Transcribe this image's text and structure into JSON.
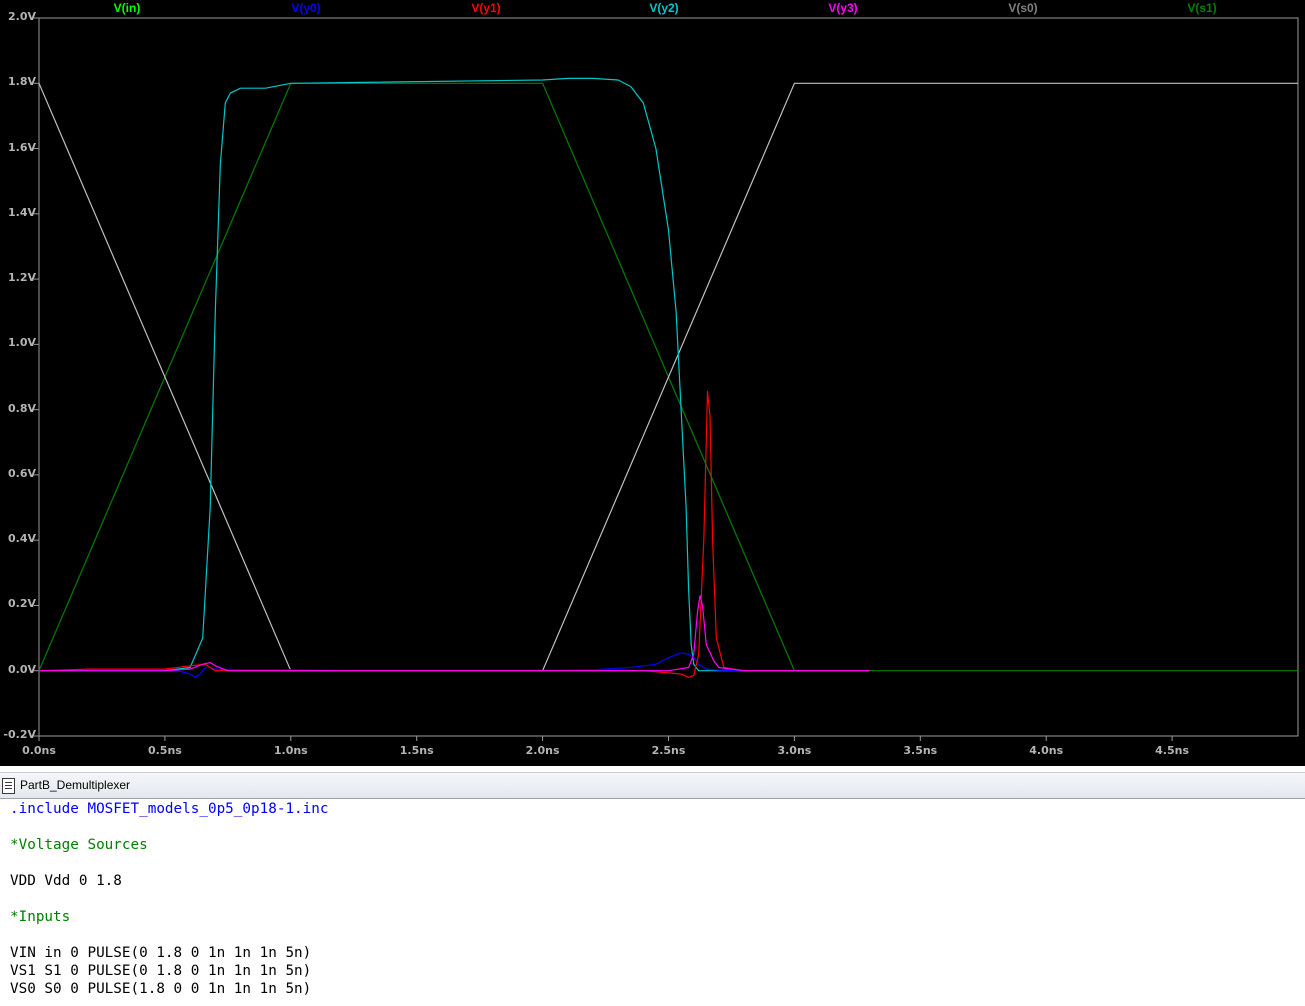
{
  "plot": {
    "background": "#000000",
    "traces": [
      {
        "label": "V(in)",
        "color": "#00ff00"
      },
      {
        "label": "V(y0)",
        "color": "#0000ff"
      },
      {
        "label": "V(y1)",
        "color": "#ff0000"
      },
      {
        "label": "V(y2)",
        "color": "#00c8c8"
      },
      {
        "label": "V(y3)",
        "color": "#ff00ff"
      },
      {
        "label": "V(s0)",
        "color": "#808080"
      },
      {
        "label": "V(s1)",
        "color": "#008000"
      }
    ],
    "y_ticks": [
      "2.0V",
      "1.8V",
      "1.6V",
      "1.4V",
      "1.2V",
      "1.0V",
      "0.8V",
      "0.6V",
      "0.4V",
      "0.2V",
      "0.0V",
      "-0.2V"
    ],
    "x_ticks": [
      "0.0ns",
      "0.5ns",
      "1.0ns",
      "1.5ns",
      "2.0ns",
      "2.5ns",
      "3.0ns",
      "3.5ns",
      "4.0ns",
      "4.5ns"
    ]
  },
  "chart_data": {
    "type": "line",
    "xlabel": "",
    "ylabel": "",
    "xlim": [
      0,
      5.0
    ],
    "ylim": [
      -0.2,
      2.0
    ],
    "x_unit": "ns",
    "y_unit": "V",
    "grid": false,
    "legend": "top",
    "series": [
      {
        "name": "V(s1)",
        "color": "#008000",
        "x": [
          0,
          1.0,
          2.0,
          3.0,
          5.0
        ],
        "y": [
          0,
          1.8,
          1.8,
          0,
          0
        ]
      },
      {
        "name": "V(s0)",
        "color": "#c0c0c0",
        "x": [
          0,
          1.0,
          2.0,
          3.0,
          5.0
        ],
        "y": [
          1.8,
          0,
          0,
          1.8,
          1.8
        ]
      },
      {
        "name": "V(y2)",
        "color": "#00c8c8",
        "x": [
          0,
          0.5,
          0.6,
          0.65,
          0.68,
          0.7,
          0.72,
          0.74,
          0.76,
          0.8,
          0.9,
          1.0,
          2.0,
          2.1,
          2.2,
          2.3,
          2.35,
          2.4,
          2.45,
          2.5,
          2.53,
          2.55,
          2.57,
          2.58,
          2.59,
          2.6,
          2.62,
          2.65,
          2.7,
          2.8,
          3.0,
          3.3
        ],
        "y": [
          0,
          0,
          0.01,
          0.1,
          0.5,
          1.1,
          1.55,
          1.74,
          1.77,
          1.785,
          1.785,
          1.8,
          1.81,
          1.815,
          1.815,
          1.81,
          1.79,
          1.74,
          1.6,
          1.35,
          1.1,
          0.8,
          0.5,
          0.25,
          0.08,
          0.02,
          0.0,
          0.0,
          0.0,
          0.0,
          0.0,
          0.0
        ]
      },
      {
        "name": "V(y0)",
        "color": "#0000ff",
        "x": [
          0,
          0.45,
          0.55,
          0.6,
          0.62,
          0.64,
          0.66,
          0.68,
          0.7,
          0.8,
          1.0,
          1.2,
          2.0,
          2.2,
          2.35,
          2.45,
          2.5,
          2.55,
          2.58,
          2.6,
          2.62,
          2.65,
          2.7,
          2.8,
          3.0,
          3.3
        ],
        "y": [
          0,
          0,
          0.0,
          -0.01,
          -0.02,
          -0.01,
          0.01,
          0.01,
          0.005,
          0.003,
          0.003,
          0.0,
          0.0,
          0.003,
          0.01,
          0.02,
          0.04,
          0.055,
          0.05,
          0.04,
          0.02,
          0.005,
          0.002,
          0.0,
          0.0,
          0.0
        ]
      },
      {
        "name": "V(y1)",
        "color": "#ff0000",
        "x": [
          0,
          0.2,
          0.3,
          0.5,
          0.6,
          0.66,
          0.68,
          0.7,
          0.75,
          1.0,
          2.0,
          2.4,
          2.55,
          2.58,
          2.6,
          2.62,
          2.64,
          2.655,
          2.665,
          2.675,
          2.69,
          2.72,
          2.8,
          3.0,
          3.3
        ],
        "y": [
          0,
          0.005,
          0.005,
          0.005,
          0.015,
          0.02,
          0.01,
          0.0,
          0.0,
          0.0,
          0.0,
          0.0,
          -0.01,
          -0.02,
          -0.015,
          0.05,
          0.4,
          0.855,
          0.78,
          0.4,
          0.1,
          0.01,
          0.0,
          0.0,
          0.0
        ]
      },
      {
        "name": "V(y3)",
        "color": "#ff00ff",
        "x": [
          0,
          0.5,
          0.6,
          0.65,
          0.68,
          0.7,
          0.75,
          1.0,
          2.0,
          2.5,
          2.58,
          2.6,
          2.615,
          2.625,
          2.635,
          2.65,
          2.68,
          2.7,
          2.8,
          3.0,
          3.3
        ],
        "y": [
          0,
          0,
          0.005,
          0.02,
          0.025,
          0.015,
          0.0,
          0.0,
          0.0,
          0.0,
          0.01,
          0.05,
          0.18,
          0.23,
          0.2,
          0.08,
          0.03,
          0.01,
          0.0,
          0.0,
          0.0
        ]
      }
    ]
  },
  "editor": {
    "tab_title": "PartB_Demultiplexer",
    "icon": "document-icon",
    "lines": [
      {
        "text": ".include MOSFET_models_0p5_0p18-1.inc",
        "color": "#0000ff"
      },
      {
        "text": "",
        "color": "#000000"
      },
      {
        "text": "*Voltage Sources",
        "color": "#008000"
      },
      {
        "text": "",
        "color": "#000000"
      },
      {
        "text": "VDD Vdd 0 1.8",
        "color": "#000000"
      },
      {
        "text": "",
        "color": "#000000"
      },
      {
        "text": "*Inputs",
        "color": "#008000"
      },
      {
        "text": "",
        "color": "#000000"
      },
      {
        "text": "VIN in 0 PULSE(0 1.8 0 1n 1n 1n 5n)",
        "color": "#000000"
      },
      {
        "text": "VS1 S1 0 PULSE(0 1.8 0 1n 1n 1n 5n)",
        "color": "#000000"
      },
      {
        "text": "VS0 S0 0 PULSE(1.8 0 0 1n 1n 1n 5n)",
        "color": "#000000"
      }
    ]
  }
}
